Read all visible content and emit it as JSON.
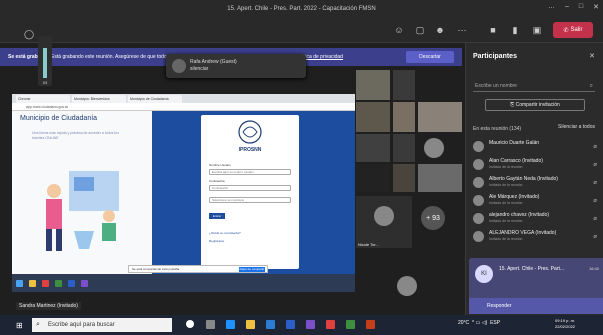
{
  "window": {
    "title": "15. Apert. Chile - Pres. Part. 2022 - Capacitación FMSN",
    "controls": [
      "…",
      "–",
      "□",
      "✕"
    ]
  },
  "toolbar": {
    "leave_label": "Salir",
    "icons": [
      "people-icon",
      "chat-icon",
      "react-icon",
      "more-icon",
      "camera-icon",
      "mic-icon",
      "share-icon"
    ]
  },
  "mic_meter": {
    "value": "03"
  },
  "banner": {
    "text_bold": "Se está grabando",
    "text": " Está grabando este reunión. Asegúrese de que todos los participantes sepan que se está grabando. Consulte",
    "link": "Política de privacidad",
    "button": "Descartar"
  },
  "popup": {
    "line1": "Rafa Andrew (Guest)",
    "line2": "silenciar"
  },
  "shared": {
    "tabs": [
      "Chrome",
      "Municipio: Bienvenidos",
      "Municipio de Ciudadanía"
    ],
    "address": "app.muni.ciudadano.gov.ar",
    "left_title": "Municipio de Ciudadanía",
    "left_text": "Una forma más rápida y práctica de acceder a todos tus trámites ONLINE",
    "brand": "IPROSNN",
    "lbl_user": "Nombre Usuario",
    "user_placeholder": "Escriba aquí su email o usuario",
    "lbl_pass": "Contraseña",
    "pass_placeholder": "Contraseña",
    "select_placeholder": "Seleccione su municipio",
    "go": "Entrar",
    "forgot": "¿Olvidó su contraseña?",
    "register": "Registrarse",
    "download_text": "Se está compartiendo esta pestaña",
    "download_btn": "Dejar de compartir"
  },
  "presenter_name": "Sandra Martinez (Invitado)",
  "tiles": {
    "nicole": "Nicole Tor...",
    "more": "+ 93"
  },
  "participants": {
    "title": "Participantes",
    "search": "Escribe un nombre",
    "share_invite": "Compartir invitación",
    "in_meeting": "En esta reunión (134)",
    "mute_all": "Silenciar a todos",
    "list": [
      {
        "name": "Mauricio Duarte Galán",
        "role": ""
      },
      {
        "name": "Alan Carrasco (Invitado)",
        "role": "Invitado de la reunión"
      },
      {
        "name": "Alberto Gaytán Neda (Invitado)",
        "role": "Invitado de la reunión"
      },
      {
        "name": "Ale Márquez (Invitado)",
        "role": "Invitado de la reunión"
      },
      {
        "name": "alejandro chavez (Invitado)",
        "role": "Invitado de la reunión"
      },
      {
        "name": "ALEJANDRO VEGA (Invitado)",
        "role": "Invitado de la reunión"
      }
    ]
  },
  "notification": {
    "initials": "KI",
    "title": "15. Apert. Chile - Pres. Part...",
    "time": "16:40",
    "action": "Responder"
  },
  "taskbar": {
    "search": "Escribe aquí para buscar",
    "temp": "20°C",
    "lang": "ESP",
    "time": "09:19 p. m.",
    "date": "22/02/2022"
  },
  "colors": {
    "accent": "#5b5fc7",
    "leave": "#c4314b",
    "site_blue": "#1d4d9e"
  }
}
